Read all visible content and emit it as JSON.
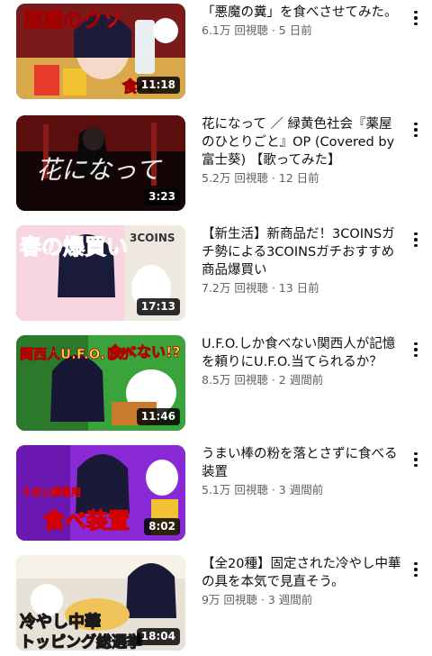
{
  "videos": [
    {
      "title": "「悪魔の糞」を食べさせてみた。",
      "views": "6.1万 回視聴",
      "age": "5 日前",
      "duration": "11:18",
      "thumb_text": "悪魔のクソ",
      "thumb_text2": "食べ",
      "icon": "more-vert-icon"
    },
    {
      "title": "花になって ／ 緑黄色社会『薬屋のひとりごと』OP (Covered by 富士葵) 【歌ってみた】",
      "views": "5.2万 回視聴",
      "age": "12 日前",
      "duration": "3:23",
      "thumb_text": "花になって",
      "icon": "more-vert-icon"
    },
    {
      "title": "【新生活】新商品だ！3COINSガチ勢による3COINSガチおすすめ商品爆買い",
      "views": "7.2万 回視聴",
      "age": "13 日前",
      "duration": "17:13",
      "thumb_text": "春の爆買い",
      "thumb_text2": "3COINS",
      "icon": "more-vert-icon"
    },
    {
      "title": "U.F.O.しか食べない関西人が記憶を頼りにU.F.O.当てられるか？",
      "views": "8.5万 回視聴",
      "age": "2 週間前",
      "duration": "11:46",
      "thumb_text": "関西人U.F.O.しか",
      "thumb_text2": "食べない!?",
      "icon": "more-vert-icon"
    },
    {
      "title": "うまい棒の粉を落とさずに食べる装置",
      "views": "5.1万 回視聴",
      "age": "3 週間前",
      "duration": "8:02",
      "thumb_text": "食べ装置",
      "thumb_text2": "うまい棒専用",
      "icon": "more-vert-icon"
    },
    {
      "title": "【全20種】固定された冷やし中華の具を本気で見直そう。",
      "views": "9万 回視聴",
      "age": "3 週間前",
      "duration": "18:04",
      "thumb_text": "冷やし中華",
      "thumb_text2": "トッピング総選挙",
      "icon": "more-vert-icon"
    }
  ],
  "separator": " · ",
  "colors": {
    "title": "#0f0f0f",
    "meta": "#606060",
    "duration_bg": "#000000"
  }
}
